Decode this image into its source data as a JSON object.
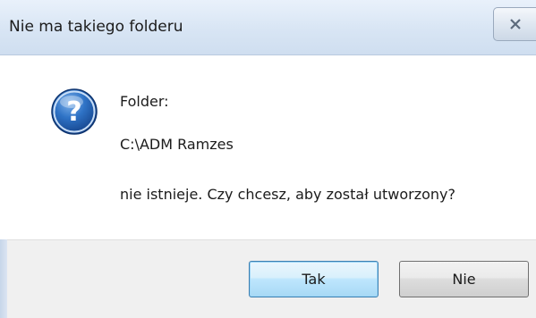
{
  "dialog": {
    "title": "Nie ma takiego folderu",
    "icon": "question-icon",
    "message_line1": "Folder:",
    "message_path": "C:\\ADM Ramzes",
    "message_line3": "nie istnieje. Czy chcesz, aby został utworzony?",
    "yes_label": "Tak",
    "no_label": "Nie"
  },
  "colors": {
    "titlebar": "#d8e5f4",
    "footer": "#f0f0f0",
    "default_button": "#bee6fd",
    "icon_blue": "#1f5fb2"
  }
}
